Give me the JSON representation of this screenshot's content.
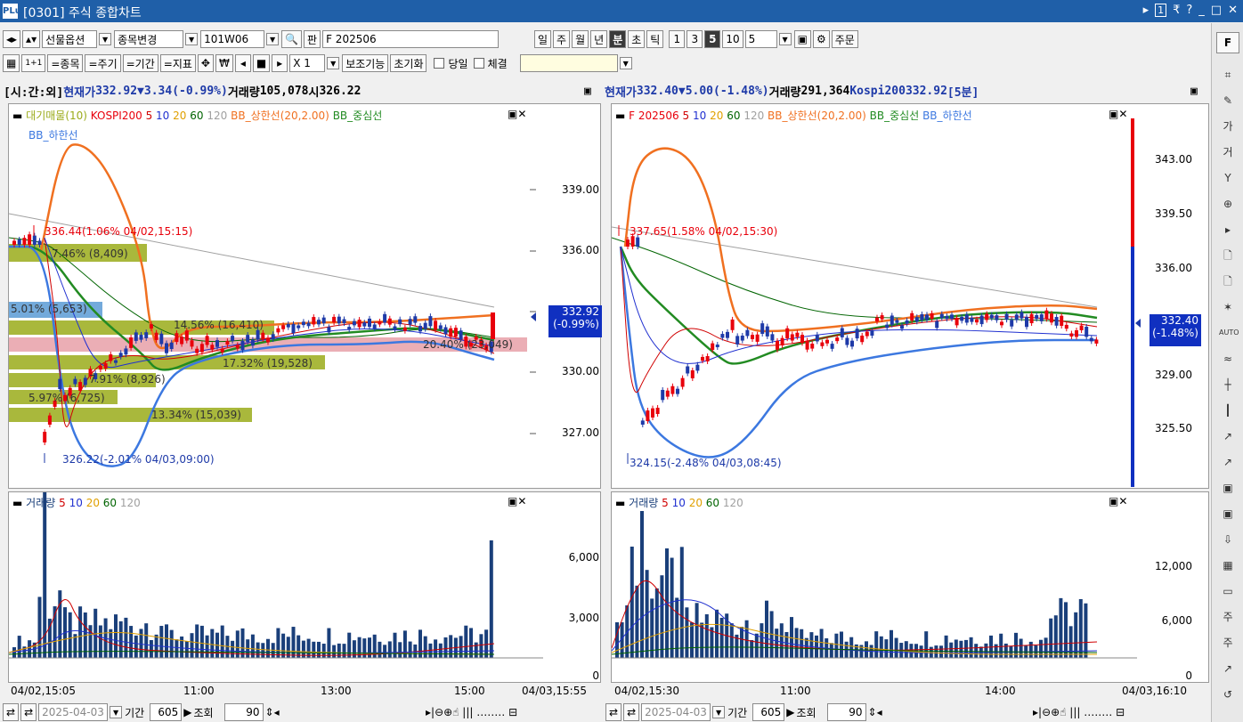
{
  "window": {
    "title": "[0301] 주식 종합차트",
    "logo": "PLus",
    "controls": [
      "▸",
      "1",
      "₹",
      "?",
      "_",
      "□",
      "✕"
    ]
  },
  "toolbar1": {
    "market": "선물옵션",
    "change_code": "종목변경",
    "code": "101W06",
    "pan": "판",
    "name": "F 202506",
    "periods": [
      "일",
      "주",
      "월",
      "년",
      "분",
      "초",
      "틱"
    ],
    "selected_period": "분",
    "minutes": [
      "1",
      "3",
      "5",
      "10"
    ],
    "selected_minute": "5",
    "minute_input": "5",
    "order": "주문"
  },
  "toolbar2": {
    "item_btn": "=종목",
    "period_btn": "=주기",
    "range_btn": "=기간",
    "indicator_btn": "=지표",
    "multiplier": "X 1",
    "aux": "보조기능",
    "reset": "초기화",
    "today": "당일",
    "exec": "체결"
  },
  "left": {
    "label": "[시:간:외]",
    "curr_label": "현재가",
    "price": "332.92",
    "arrow": "▼",
    "change": "3.34",
    "rate": "(-0.99%)",
    "vol_label": "거래량",
    "volume": "105,078",
    "open_label": "시",
    "open": "326.22",
    "legend1": [
      "대기매물(10)",
      "KOSPI200",
      "5",
      "10",
      "20",
      "60",
      "120",
      "BB_상한선(20,2.00)",
      "BB_중심선"
    ],
    "legend1b": "BB_하한선",
    "high_note": "336.44(1.06% 04/02,15:15)",
    "low_note": "326.22(-2.01% 04/03,09:00)",
    "yaxis": [
      "339.00",
      "336.00",
      "333.00",
      "330.00",
      "327.00"
    ],
    "cur_box": [
      "332.92",
      "(-0.99%)"
    ],
    "fibo": [
      "7.46% (8,409)",
      "5.01% (5,653)",
      "14.56% (16,410)",
      "17.32% (19,528)",
      "20.40% (23,049)",
      "7.91% (8,926)",
      "5.97% (6,725)",
      "13.34% (15,039)"
    ],
    "vol_legend": [
      "거래량",
      "5",
      "10",
      "20",
      "60",
      "120"
    ],
    "vol_axis": [
      "6,000",
      "3,000",
      "0"
    ],
    "xaxis": [
      "04/02,15:05",
      "11:00",
      "13:00",
      "15:00",
      "04/03,15:55"
    ],
    "date": "2025-04-03",
    "period_label": "기간",
    "count": "605",
    "query": "조회",
    "zoom": "90"
  },
  "right": {
    "label": "현재가",
    "price": "332.40",
    "arrow": "▼",
    "change": "5.00",
    "rate": "(-1.48%)",
    "vol_label": "거래량",
    "volume": "291,364",
    "idx_label": "Kospi200",
    "idx": "332.92",
    "interval": "[5분]",
    "legend1": [
      "F 202506",
      "5",
      "10",
      "20",
      "60",
      "120",
      "BB_상한선(20,2.00)",
      "BB_중심선",
      "BB_하한선"
    ],
    "high_note": "337.65(1.58% 04/02,15:30)",
    "low_note": "324.15(-2.48% 04/03,08:45)",
    "yaxis": [
      "343.00",
      "339.50",
      "336.00",
      "332.50",
      "329.00",
      "325.50"
    ],
    "cur_box": [
      "332.40",
      "(-1.48%)"
    ],
    "vol_legend": [
      "거래량",
      "5",
      "10",
      "20",
      "60",
      "120"
    ],
    "vol_axis": [
      "12,000",
      "6,000",
      "0"
    ],
    "xaxis": [
      "04/02,15:30",
      "11:00",
      "14:00",
      "04/03,16:10"
    ],
    "date": "2025-04-03",
    "period_label": "기간",
    "count": "605",
    "query": "조회",
    "zoom": "90"
  },
  "side": {
    "top_btn": "F",
    "auto": "AUTO",
    "icons": [
      "chart-icon",
      "wrench-icon",
      "price-icon",
      "trade-icon",
      "y-icon",
      "zoom-icon",
      "cursor-icon",
      "scan-icon",
      "scan2-icon",
      "star-icon",
      "auto-icon",
      "line-icon",
      "candle-icon",
      "bar-icon",
      "trend-icon",
      "rise-icon",
      "img-icon",
      "img2-icon",
      "down-icon",
      "grid-icon",
      "window-icon",
      "sign-icon",
      "sign2-icon",
      "export-icon",
      "refresh-icon"
    ]
  },
  "colors": {
    "title": "#1f5fa8",
    "up": "#e8000b",
    "down": "#1e3aa8",
    "bb_upper": "#f07020",
    "bb_mid": "#228b22",
    "bb_low": "#3c78e0",
    "ma5": "#d00000",
    "ma10": "#2030d0",
    "ma20": "#e0a000",
    "ma60": "#006400",
    "ma120": "#a0a0a0",
    "fibo": "#9aab1a",
    "fibo_hl": "#e8a0a8",
    "vol_bar": "#1a3f7a"
  }
}
